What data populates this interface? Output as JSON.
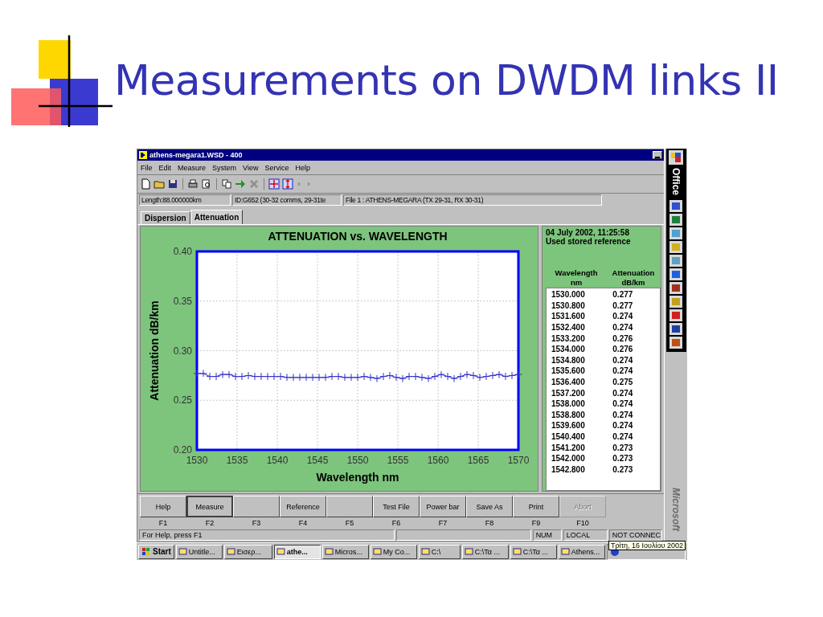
{
  "slide": {
    "title": "Measurements on DWDM links II"
  },
  "window": {
    "title": "athens-megara1.WSD - 400"
  },
  "menu": [
    "File",
    "Edit",
    "Measure",
    "System",
    "View",
    "Service",
    "Help"
  ],
  "info_fields": [
    "Length:88.000000km",
    "ID:G652 (30-32 comms, 29-31te",
    "File 1 : ATHENS-MEGARA (TX 29-31, RX 30-31)"
  ],
  "tabs": [
    {
      "label": "Dispersion",
      "selected": false
    },
    {
      "label": "Attenuation",
      "selected": true
    }
  ],
  "chart_data": {
    "type": "line",
    "title": "ATTENUATION vs. WAVELENGTH",
    "xlabel": "Wavelength nm",
    "ylabel": "Attenuation dB/km",
    "xlim": [
      1530,
      1570
    ],
    "ylim": [
      0.2,
      0.4
    ],
    "xticks": [
      1530,
      1535,
      1540,
      1545,
      1550,
      1555,
      1560,
      1565,
      1570
    ],
    "yticks": [
      {
        "value": 0.2,
        "label": "0.20"
      },
      {
        "value": 0.25,
        "label": "0.25"
      },
      {
        "value": 0.3,
        "label": "0.30"
      },
      {
        "value": 0.35,
        "label": "0.35"
      },
      {
        "value": 0.4,
        "label": "0.40"
      }
    ],
    "x": [
      1530,
      1530.8,
      1531.6,
      1532.4,
      1533.2,
      1534,
      1534.8,
      1535.6,
      1536.4,
      1537.2,
      1538,
      1538.8,
      1539.6,
      1540.4,
      1541.2,
      1542,
      1542.8,
      1543.6,
      1544.4,
      1545.2,
      1546,
      1546.8,
      1547.6,
      1548.4,
      1549.2,
      1550,
      1550.8,
      1551.6,
      1552.4,
      1553.2,
      1554,
      1554.8,
      1555.6,
      1556.4,
      1557.2,
      1558,
      1558.8,
      1559.6,
      1560.4,
      1561.2,
      1562,
      1562.8,
      1563.6,
      1564.4,
      1565.2,
      1566,
      1566.8,
      1567.6,
      1568.4,
      1569.2,
      1570
    ],
    "grid": true,
    "series": [
      {
        "color": "#3333cc",
        "values": [
          0.277,
          0.277,
          0.274,
          0.274,
          0.276,
          0.276,
          0.274,
          0.274,
          0.275,
          0.274,
          0.274,
          0.274,
          0.274,
          0.274,
          0.273,
          0.273,
          0.273,
          0.273,
          0.273,
          0.273,
          0.273,
          0.274,
          0.274,
          0.273,
          0.273,
          0.273,
          0.274,
          0.273,
          0.272,
          0.274,
          0.275,
          0.273,
          0.272,
          0.274,
          0.274,
          0.273,
          0.272,
          0.274,
          0.276,
          0.274,
          0.272,
          0.274,
          0.276,
          0.275,
          0.273,
          0.274,
          0.275,
          0.276,
          0.274,
          0.275,
          0.276
        ]
      }
    ]
  },
  "results": {
    "timestamp": "04 July 2002, 11:25:58",
    "note": "Used stored reference",
    "columns": [
      {
        "name": "Wavelength",
        "unit": "nm"
      },
      {
        "name": "Attenuation",
        "unit": "dB/km"
      }
    ],
    "rows": [
      [
        "1530.000",
        "0.277"
      ],
      [
        "1530.800",
        "0.277"
      ],
      [
        "1531.600",
        "0.274"
      ],
      [
        "1532.400",
        "0.274"
      ],
      [
        "1533.200",
        "0.276"
      ],
      [
        "1534.000",
        "0.276"
      ],
      [
        "1534.800",
        "0.274"
      ],
      [
        "1535.600",
        "0.274"
      ],
      [
        "1536.400",
        "0.275"
      ],
      [
        "1537.200",
        "0.274"
      ],
      [
        "1538.000",
        "0.274"
      ],
      [
        "1538.800",
        "0.274"
      ],
      [
        "1539.600",
        "0.274"
      ],
      [
        "1540.400",
        "0.274"
      ],
      [
        "1541.200",
        "0.273"
      ],
      [
        "1542.000",
        "0.273"
      ],
      [
        "1542.800",
        "0.273"
      ]
    ]
  },
  "function_keys": [
    {
      "key": "F1",
      "label": "Help",
      "selected": false,
      "disabled": false
    },
    {
      "key": "F2",
      "label": "Measure",
      "selected": true,
      "disabled": false
    },
    {
      "key": "F3",
      "selected": false,
      "disabled": false
    },
    {
      "key": "F4",
      "label": "Reference",
      "selected": false,
      "disabled": false
    },
    {
      "key": "F5",
      "selected": false,
      "disabled": false
    },
    {
      "key": "F6",
      "label": "Test File",
      "selected": false,
      "disabled": false
    },
    {
      "key": "F7",
      "label": "Power bar",
      "selected": false,
      "disabled": false
    },
    {
      "key": "F8",
      "label": "Save As",
      "selected": false,
      "disabled": false
    },
    {
      "key": "F9",
      "label": "Print",
      "selected": false,
      "disabled": false
    },
    {
      "key": "F10",
      "label": "Abort",
      "selected": false,
      "disabled": true
    }
  ],
  "status_bar": {
    "message": "For Help, press F1",
    "indicators": [
      "NUM",
      "LOCAL",
      "NOT CONNEC"
    ]
  },
  "office_bar": {
    "title": "Office",
    "footer": "Microsoft"
  },
  "taskbar": {
    "start": "Start",
    "tasks": [
      {
        "label": "Untitle...",
        "selected": false
      },
      {
        "label": "Εισερ...",
        "selected": false
      },
      {
        "label": "athe...",
        "selected": true
      },
      {
        "label": "Micros...",
        "selected": false
      },
      {
        "label": "My Co...",
        "selected": false
      },
      {
        "label": "C:\\",
        "selected": false
      },
      {
        "label": "C:\\Τα ...",
        "selected": false
      },
      {
        "label": "C:\\Τα ...",
        "selected": false
      },
      {
        "label": "Athens...",
        "selected": false
      }
    ],
    "tooltip": "Τρίτη, 16 Ιουλίου 2002"
  }
}
